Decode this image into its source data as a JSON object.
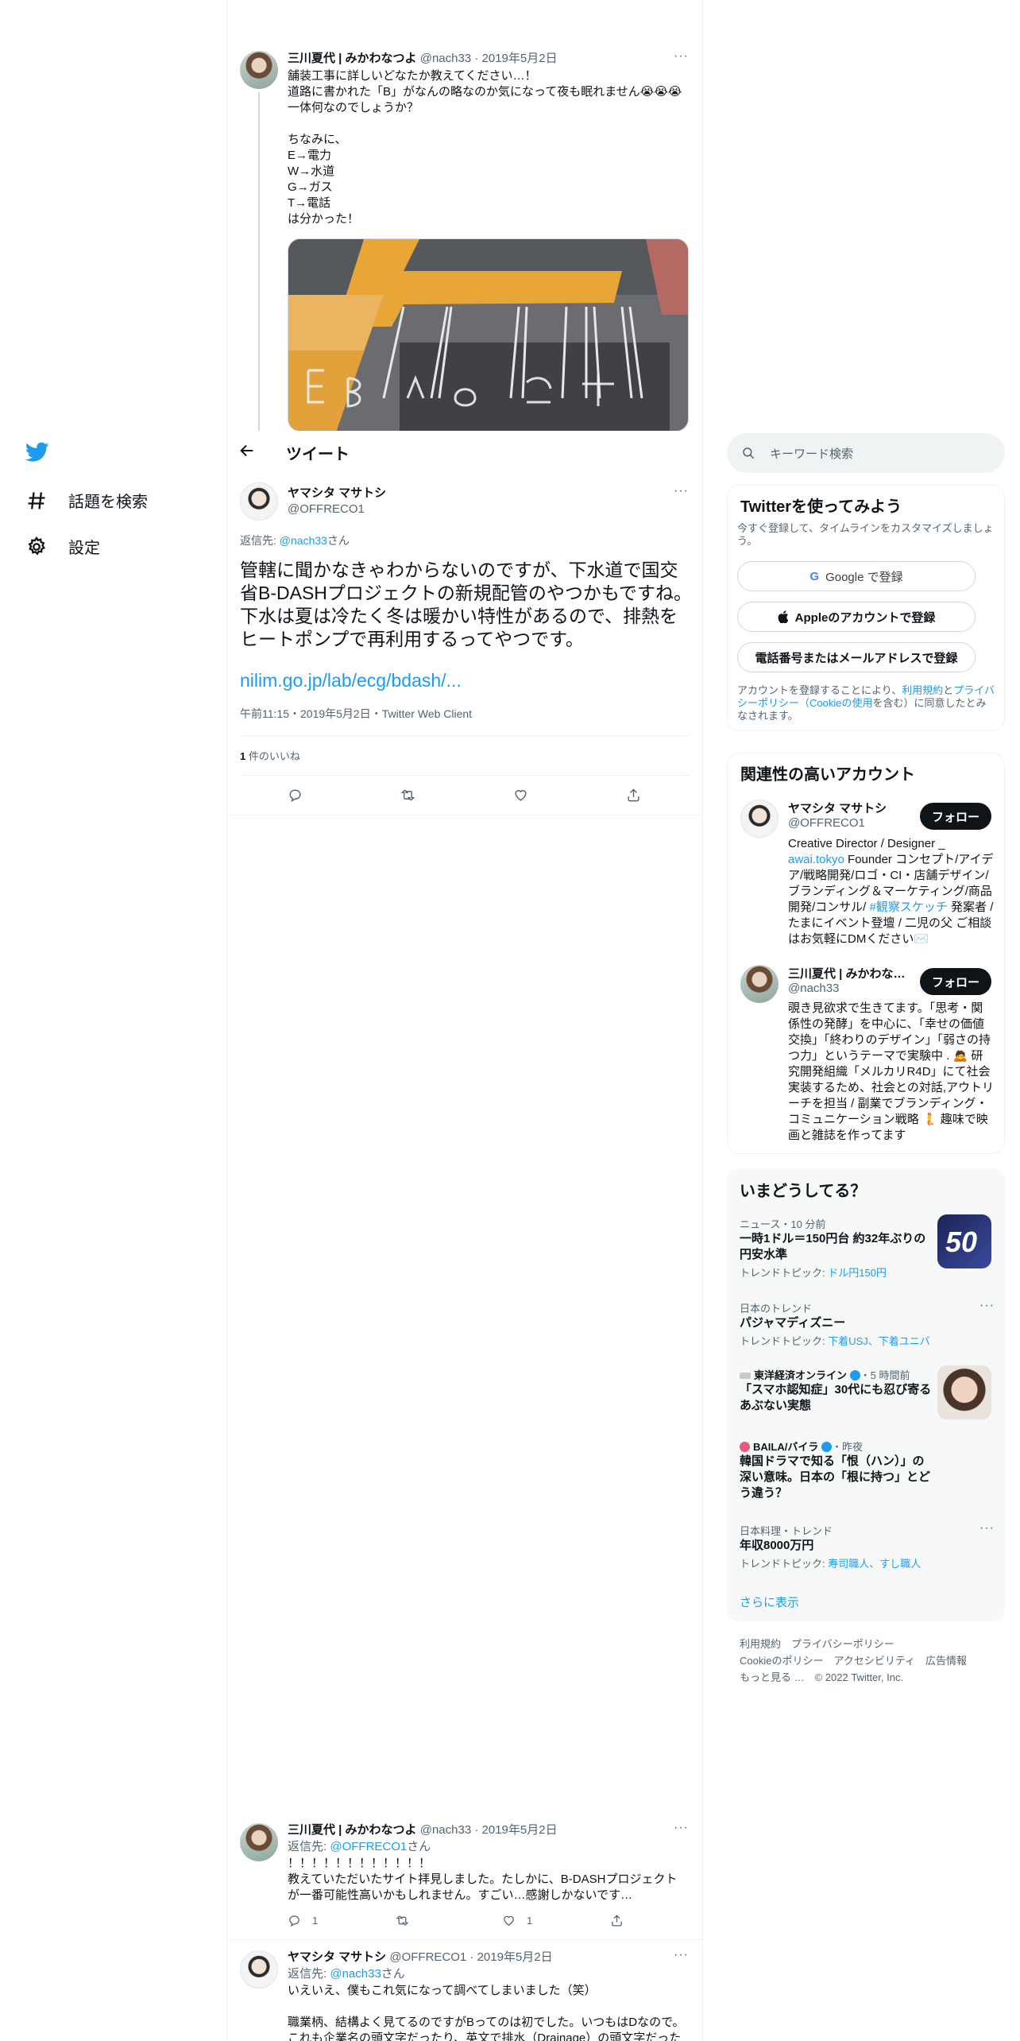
{
  "nav": {
    "items": [
      {
        "label": "話題を検索",
        "icon": "hash-icon"
      },
      {
        "label": "設定",
        "icon": "gear-icon"
      }
    ]
  },
  "header": {
    "title": "ツイート"
  },
  "parent_tweet": {
    "name": "三川夏代 | みかわなつよ",
    "handle": "@nach33",
    "date": "2019年5月2日",
    "text": "舗装工事に詳しいどなたか教えてください…！\n道路に書かれた「B」がなんの略なのか気になって夜も眠れません😭😭😭\n一体何なのでしょうか？\n\nちなみに、\nE→電力\nW→水道\nG→ガス\nT→電話\nは分かった！"
  },
  "main_tweet": {
    "name": "ヤマシタ マサトシ",
    "handle": "@OFFRECO1",
    "reply_prefix": "返信先: ",
    "reply_to": "@nach33",
    "reply_suffix": "さん",
    "text": "管轄に聞かなきゃわからないのですが、下水道で国交省B-DASHプロジェクトの新規配管のやつかもですね。下水は夏は冷たく冬は暖かい特性があるので、排熱をヒートポンプで再利用するってやつです。",
    "link": "nilim.go.jp/lab/ecg/bdash/...",
    "meta": "午前11:15・2019年5月2日・Twitter Web Client",
    "like_count": "1",
    "like_label": " 件のいいね"
  },
  "search": {
    "placeholder": "キーワード検索"
  },
  "signup": {
    "title": "Twitterを使ってみよう",
    "subtitle": "今すぐ登録して、タイムラインをカスタマイズしましょう。",
    "google": "Google で登録",
    "apple": "Appleのアカウントで登録",
    "phone": "電話番号またはメールアドレスで登録",
    "terms_1": "アカウントを登録することにより、",
    "terms_link1": "利用規約",
    "terms_2": "と",
    "terms_link2": "プライバシーポリシー（Cookieの使用",
    "terms_3": "を含む）に同意したとみなされます。"
  },
  "accounts": {
    "title": "関連性の高いアカウント",
    "follow_label": "フォロー",
    "items": [
      {
        "name": "ヤマシタ マサトシ",
        "handle": "@OFFRECO1",
        "bio_1": "Creative Director / Designer _",
        "bio_link1": "awai.tokyo",
        "bio_2": " Founder コンセプト/アイデア/戦略開発/ロゴ・CI・店舗デザイン/ブランディング＆マーケティング/商品開発/コンサル/ ",
        "bio_link2": "#観察スケッチ",
        "bio_3": " 発案者 / たまにイベント登壇 / 二児の父 ご相談はお気軽にDMください✉️"
      },
      {
        "name": "三川夏代 | みかわな…",
        "handle": "@nach33",
        "bio": "覗き見欲求で生きてます。「思考・関係性の発酵」を中心に、「幸せの価値交換」「終わりのデザイン」「弱さの持つ力」というテーマで実験中 . 🙇 研究開発組織「メルカリR4D」にて社会実装するため、社会との対話,アウトリーチを担当 / 副業でブランディング・コミュニケーション戦略 🧜 趣味で映画と雑誌を作ってます"
      }
    ]
  },
  "trends": {
    "title": "いまどうしてる？",
    "items": [
      {
        "meta": "ニュース・10 分前",
        "title": "一時1ドル＝150円台 約32年ぶりの円安水準",
        "topic_prefix": "トレンドトピック: ",
        "topics": "ドル円150円",
        "thumb": "50"
      },
      {
        "meta": "日本のトレンド",
        "title": "パジャマディズニー",
        "topic_prefix": "トレンドトピック: ",
        "topics": "下着USJ、下着ユニバ"
      },
      {
        "source": "東洋経済オンライン",
        "meta": "・5 時間前",
        "title": "「スマホ認知症」30代にも忍び寄るあぶない実態"
      },
      {
        "source": "BAILA/バイラ",
        "meta": "・昨夜",
        "title": "韓国ドラマで知る「恨（ハン）」の深い意味。日本の「根に持つ」とどう違う？"
      },
      {
        "meta": "日本料理・トレンド",
        "title": "年収8000万円",
        "topic_prefix": "トレンドトピック: ",
        "topics": "寿司職人、すし職人"
      }
    ],
    "show_more": "さらに表示"
  },
  "footer": {
    "line1": "利用規約　プライバシーポリシー",
    "line2": "Cookieのポリシー　アクセシビリティ　広告情報",
    "line3": "もっと見る …　© 2022 Twitter, Inc."
  },
  "replies": [
    {
      "name": "三川夏代 | みかわなつよ",
      "handle": "@nach33",
      "date": "2019年5月2日",
      "reply_prefix": "返信先: ",
      "reply_to": "@OFFRECO1",
      "reply_suffix": "さん",
      "text": "！！！！！！！！！！！！\n教えていただいたサイト拝見しました。たしかに、B-DASHプロジェクトが一番可能性高いかもしれません。すごい…感謝しかないです…",
      "reply_count": "1",
      "like_count": "1"
    },
    {
      "name": "ヤマシタ マサトシ",
      "handle": "@OFFRECO1",
      "date": "2019年5月2日",
      "reply_prefix": "返信先: ",
      "reply_to": "@nach33",
      "reply_suffix": "さん",
      "text": "いえいえ、僕もこれ気になって調べてしまいました（笑）\n\n職業柄、結構よく見てるのですがBってのは初でした。いつもはDなので。\nこれも企業名の頭文字だったり、英文で排水（Drainage）の頭文字だった"
    }
  ]
}
